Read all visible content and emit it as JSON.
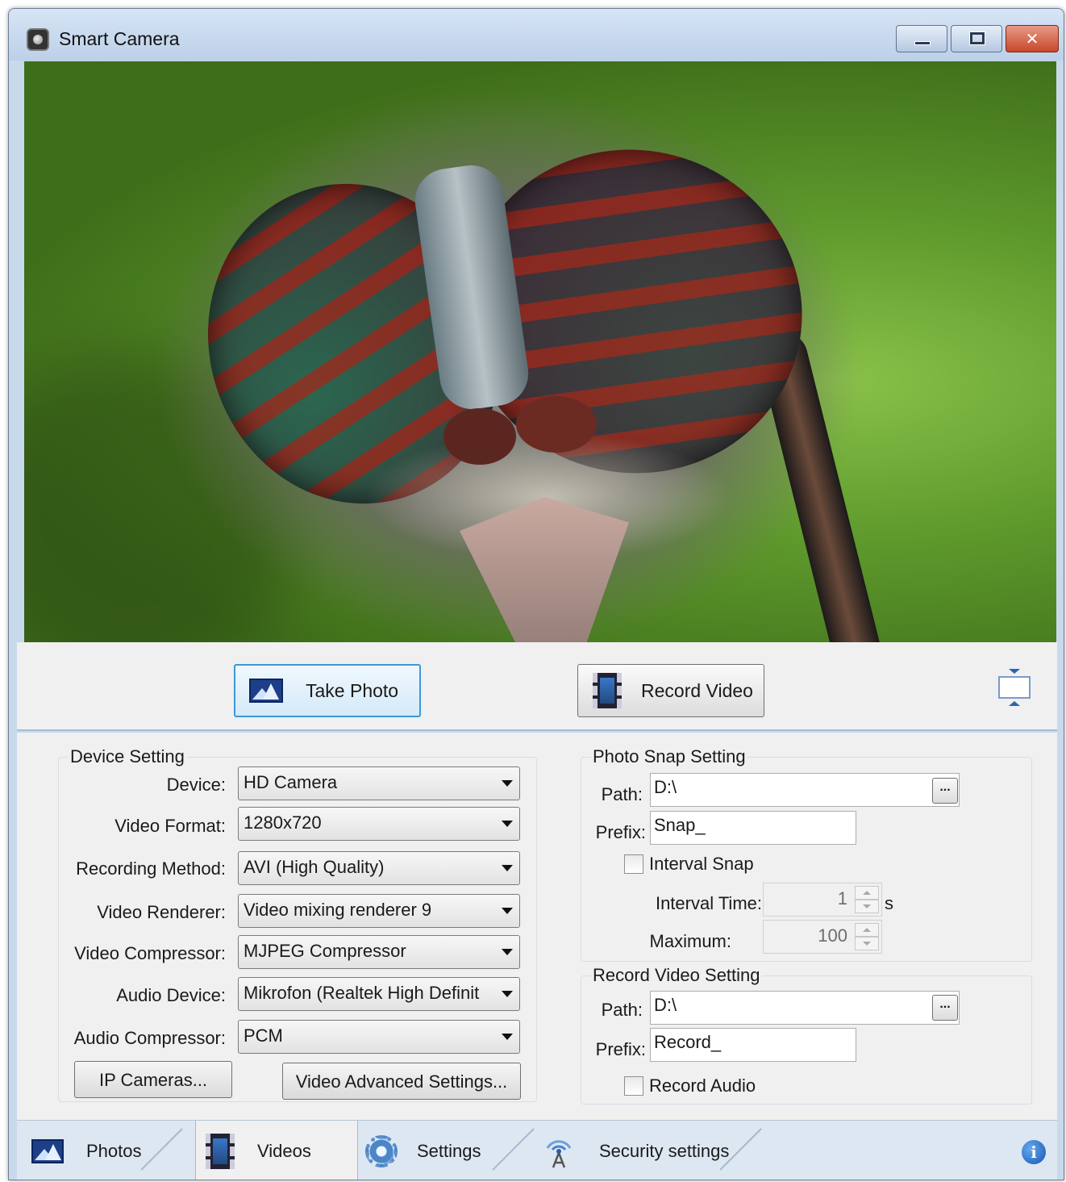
{
  "window": {
    "title": "Smart Camera",
    "accent": "#3c98d8"
  },
  "actions": {
    "take_photo": "Take Photo",
    "record_video": "Record Video"
  },
  "device_setting": {
    "title": "Device Setting",
    "rows": [
      {
        "label": "Device:",
        "value": "HD Camera"
      },
      {
        "label": "Video Format:",
        "value": "1280x720"
      },
      {
        "label": "Recording Method:",
        "value": "AVI (High Quality)"
      },
      {
        "label": "Video Renderer:",
        "value": "Video mixing renderer 9"
      },
      {
        "label": "Video Compressor:",
        "value": "MJPEG Compressor"
      },
      {
        "label": "Audio Device:",
        "value": "Mikrofon (Realtek High Definit"
      },
      {
        "label": "Audio Compressor:",
        "value": "PCM"
      }
    ],
    "ip_cameras_button": "IP Cameras...",
    "video_advanced_button": "Video Advanced Settings..."
  },
  "photo_snap": {
    "title": "Photo Snap Setting",
    "path_label": "Path:",
    "path_value": "D:\\",
    "browse": "...",
    "prefix_label": "Prefix:",
    "prefix_value": "Snap_",
    "interval_snap_label": "Interval Snap",
    "interval_snap_checked": false,
    "interval_time_label": "Interval Time:",
    "interval_time_value": "1",
    "interval_time_unit": "s",
    "maximum_label": "Maximum:",
    "maximum_value": "100"
  },
  "record_video": {
    "title": "Record Video Setting",
    "path_label": "Path:",
    "path_value": "D:\\",
    "browse": "...",
    "prefix_label": "Prefix:",
    "prefix_value": "Record_",
    "record_audio_label": "Record Audio",
    "record_audio_checked": false
  },
  "tabs": [
    {
      "label": "Photos",
      "icon": "photo-icon",
      "active": false
    },
    {
      "label": "Videos",
      "icon": "film-icon",
      "active": true
    },
    {
      "label": "Settings",
      "icon": "gear-icon",
      "active": false
    },
    {
      "label": "Security settings",
      "icon": "antenna-icon",
      "active": false
    }
  ],
  "info_glyph": "i"
}
